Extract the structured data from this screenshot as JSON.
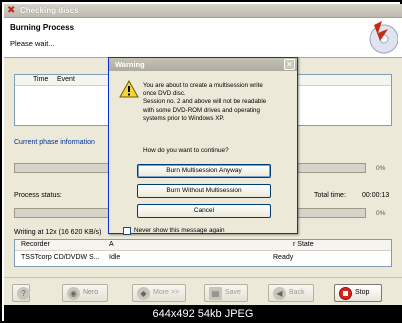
{
  "window": {
    "title": "Checking discs"
  },
  "header": {
    "title": "Burning Process",
    "subtitle": "Please wait..."
  },
  "log": {
    "col_time": "Time",
    "col_event": "Event"
  },
  "phase": {
    "label": "Current phase information",
    "percent": "0%"
  },
  "process": {
    "label": "Process status:",
    "percent": "0%"
  },
  "total_time": {
    "label": "Total time:",
    "value": "00:00:13"
  },
  "writing": {
    "text": "Writing at 12x (16 620 KB/s)"
  },
  "recorders": {
    "columns": [
      "Recorder",
      "A",
      "r State"
    ],
    "rows": [
      {
        "recorder": "TSSTcorp CD/DVDW S...",
        "status": "Idle",
        "state": "Ready"
      }
    ]
  },
  "toolbar": {
    "nero_label": "Nero",
    "more_label": "More >>",
    "save_label": "Save",
    "back_label": "Back",
    "stop_label": "Stop"
  },
  "dialog": {
    "title": "Warning",
    "message_lines": [
      "You are about to create a multisession write",
      "once DVD disc.",
      "Session no. 2 and above will not be readable",
      "with some DVD-ROM drives and operating",
      "systems prior to Windows XP."
    ],
    "question": "How do you want to continue?",
    "burn_anyway_label": "Burn Multisession Anyway",
    "burn_without_label": "Burn Without Multisession",
    "cancel_label": "Cancel",
    "checkbox_label": "Never show this message again"
  },
  "image_caption": "644x492  54kb  JPEG",
  "colors": {
    "accent_blue": "#003399",
    "stop_red": "#d8261b",
    "logo_red": "#c62b16"
  }
}
